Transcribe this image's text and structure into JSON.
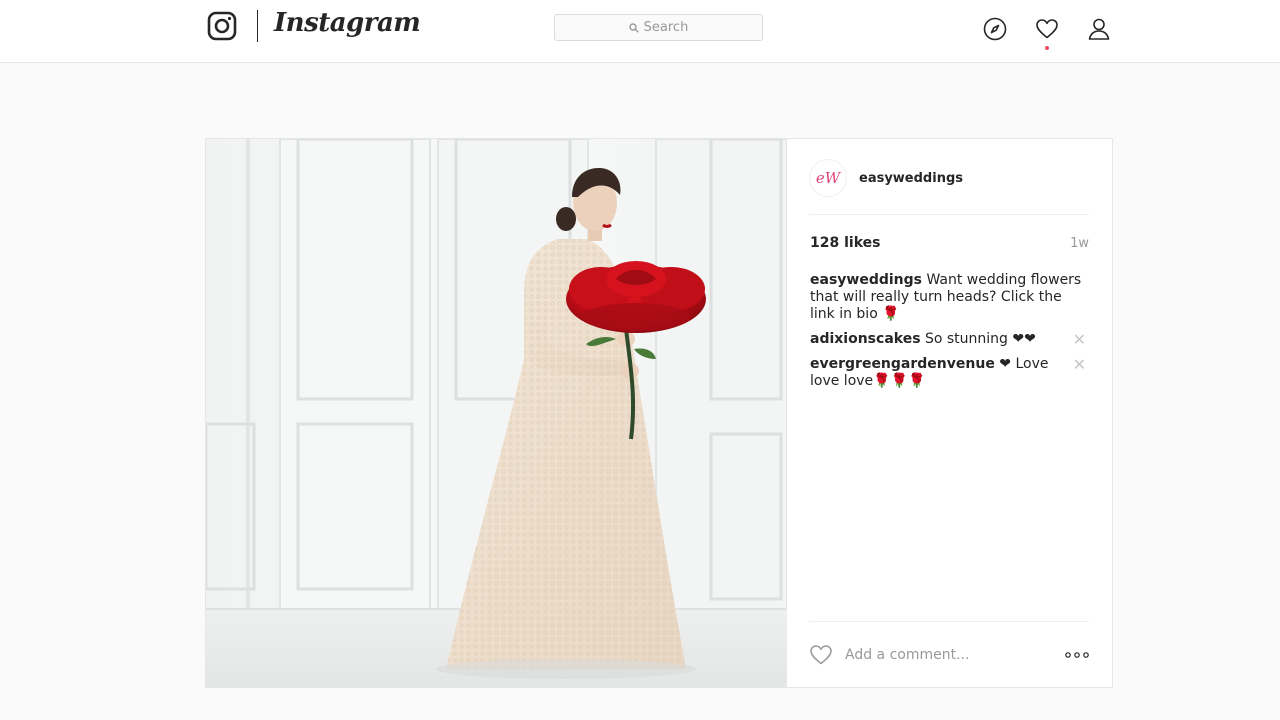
{
  "nav": {
    "wordmark": "Instagram",
    "search_placeholder": "Search",
    "icons": [
      "instagram-logo-icon",
      "compass-icon",
      "heart-icon",
      "profile-icon"
    ],
    "notification_dot_color": "#ed4956"
  },
  "post": {
    "avatar_monogram": "eW",
    "username": "easyweddings",
    "likes": "128 likes",
    "age": "1w",
    "caption": {
      "user": "easyweddings",
      "text": "Want wedding flowers that will really turn heads? Click the link in bio 🌹"
    },
    "comments": [
      {
        "user": "adixionscakes",
        "text": "So stunning ❤❤"
      },
      {
        "user": "evergreengardenvenue",
        "text": "❤ Love love love🌹🌹🌹"
      }
    ],
    "comment_placeholder": "Add a comment...",
    "accent_color": "#e0457b"
  }
}
